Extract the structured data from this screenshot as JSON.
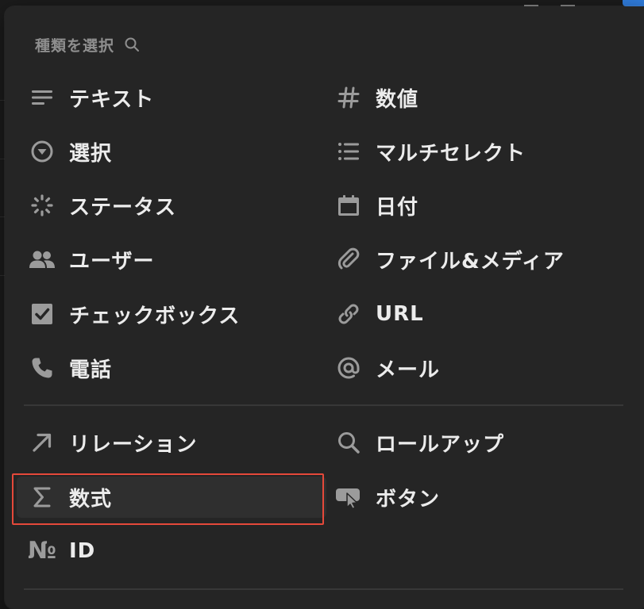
{
  "menu": {
    "header": "種類を選択",
    "left_items": [
      {
        "label": "テキスト",
        "icon": "text-lines-icon"
      },
      {
        "label": "選択",
        "icon": "select-circle-icon"
      },
      {
        "label": "ステータス",
        "icon": "status-spinner-icon"
      },
      {
        "label": "ユーザー",
        "icon": "users-icon"
      },
      {
        "label": "チェックボックス",
        "icon": "checkbox-icon"
      },
      {
        "label": "電話",
        "icon": "phone-icon"
      }
    ],
    "right_items": [
      {
        "label": "数値",
        "icon": "hash-icon"
      },
      {
        "label": "マルチセレクト",
        "icon": "bulleted-list-icon"
      },
      {
        "label": "日付",
        "icon": "calendar-icon"
      },
      {
        "label": "ファイル&メディア",
        "icon": "paperclip-icon"
      },
      {
        "label": "URL",
        "icon": "link-icon"
      },
      {
        "label": "メール",
        "icon": "at-sign-icon"
      }
    ],
    "advanced_left": [
      {
        "label": "リレーション",
        "icon": "arrow-up-right-icon"
      },
      {
        "label": "数式",
        "icon": "sigma-icon",
        "selected": true
      },
      {
        "label": "ID",
        "icon": "numero-icon",
        "glyph": "№"
      }
    ],
    "advanced_right": [
      {
        "label": "ロールアップ",
        "icon": "search-icon"
      },
      {
        "label": "ボタン",
        "icon": "button-cursor-icon"
      }
    ]
  },
  "colors": {
    "menu_bg": "#252525",
    "item_text": "#ececec",
    "icon": "#9b9b9b",
    "highlight_border": "#e5493a",
    "accent": "#2f7ad8"
  }
}
